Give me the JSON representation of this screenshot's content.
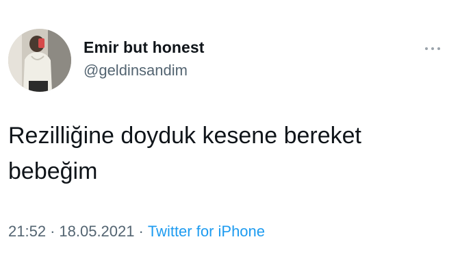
{
  "tweet": {
    "author": {
      "display_name": "Emir but honest",
      "handle": "@geldinsandim",
      "avatar_icon": "user-avatar-photo"
    },
    "more_icon": "more-options-icon",
    "text": "Rezilliğine doyduk kesene bereket\nbebeğim",
    "time": "21:52",
    "separator": "·",
    "date": "18.05.2021",
    "source": "Twitter for iPhone"
  },
  "colors": {
    "text_primary": "#0f1419",
    "text_secondary": "#536471",
    "link": "#1d9bf0",
    "background": "#ffffff"
  }
}
